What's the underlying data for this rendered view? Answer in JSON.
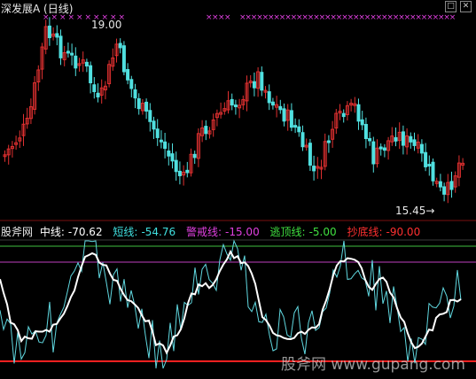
{
  "title": "深发展A (日线)",
  "price_panel": {
    "high_label": "19.00",
    "low_label": "15.45",
    "colors": {
      "up": "#e03030",
      "down": "#50e0e0",
      "signal": "#e040e0"
    }
  },
  "indicator": {
    "name": "股斧网",
    "items": [
      {
        "label": "中线:",
        "value": "-70.62",
        "color": "#ffffff"
      },
      {
        "label": "短线:",
        "value": "-54.76",
        "color": "#40e0e0"
      },
      {
        "label": "警戒线:",
        "value": "-15.00",
        "color": "#e040e0"
      },
      {
        "label": "逃顶线:",
        "value": "-5.00",
        "color": "#40e040"
      },
      {
        "label": "抄底线:",
        "value": "-90.00",
        "color": "#ff3030"
      }
    ]
  },
  "watermark": "股斧网 www.gupang.com",
  "window_buttons": {
    "minimize": "□",
    "close": "✕"
  }
}
